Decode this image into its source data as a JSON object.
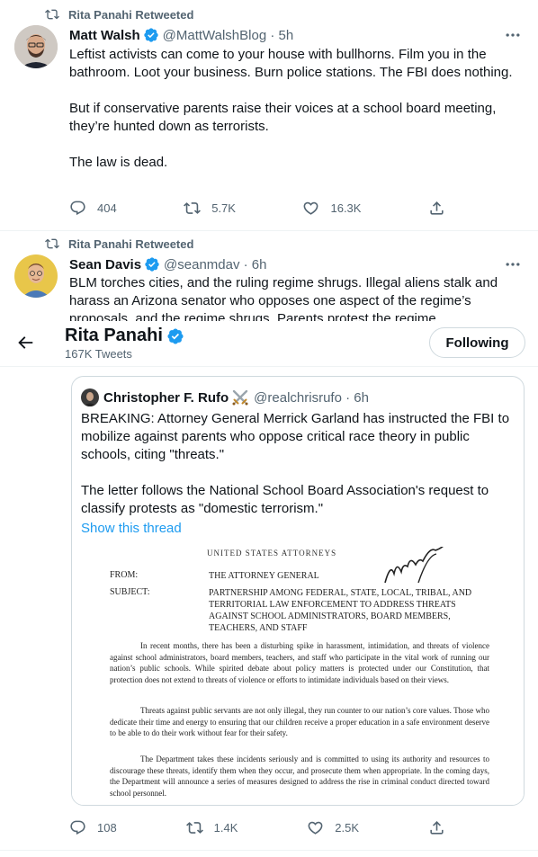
{
  "tweet1": {
    "retweet_label": "Rita Panahi Retweeted",
    "name": "Matt Walsh",
    "meta": "@MattWalshBlog · 5h",
    "paragraphs": [
      "Leftist activists can come to your house with bullhorns. Film you in the bathroom. Loot your business. Burn police stations. The FBI does nothing.",
      "But if conservative parents raise their voices at a school board meeting, they’re hunted down as terrorists.",
      "The law is dead."
    ],
    "replies": "404",
    "retweets": "5.7K",
    "likes": "16.3K"
  },
  "tweet2": {
    "retweet_label": "Rita Panahi Retweeted",
    "name": "Sean Davis",
    "meta": "@seanmdav · 6h",
    "text": "BLM torches cities, and the ruling regime shrugs. Illegal aliens stalk and harass an Arizona senator who opposes one aspect of the regime’s proposals, and the regime shrugs. Parents protest the regime"
  },
  "header": {
    "name": "Rita Panahi",
    "tweet_count": "167K Tweets",
    "follow_label": "Following"
  },
  "quote": {
    "name": "Christopher F. Rufo",
    "meta": "@realchrisrufo · 6h",
    "paragraphs": [
      "BREAKING: Attorney General Merrick Garland has instructed the FBI to mobilize against parents who oppose critical race theory in public schools, citing \"threats.\"",
      "The letter follows the National School Board Association's request to classify protests as \"domestic terrorism.\""
    ],
    "show_thread": "Show this thread",
    "document": {
      "header": "UNITED STATES ATTORNEYS",
      "from_label": "FROM:",
      "from_value": "THE ATTORNEY GENERAL",
      "subject_label": "SUBJECT:",
      "subject_value": "PARTNERSHIP AMONG FEDERAL, STATE, LOCAL, TRIBAL, AND TERRITORIAL LAW ENFORCEMENT TO ADDRESS THREATS AGAINST SCHOOL ADMINISTRATORS, BOARD MEMBERS, TEACHERS, AND STAFF",
      "para1": "In recent months, there has been a disturbing spike in harassment, intimidation, and threats of violence against school administrators, board members, teachers, and staff who participate in the vital work of running our nation’s public schools. While spirited debate about policy matters is protected under our Constitution, that protection does not extend to threats of violence or efforts to intimidate individuals based on their views.",
      "para2": "Threats against public servants are not only illegal, they run counter to our nation’s core values. Those who dedicate their time and energy to ensuring that our children receive a proper education in a safe environment deserve to be able to do their work without fear for their safety.",
      "para3": "The Department takes these incidents seriously and is committed to using its authority and resources to discourage these threats, identify them when they occur, and prosecute them when appropriate. In the coming days, the Department will announce a series of measures designed to address the rise in criminal conduct directed toward school personnel."
    }
  },
  "tweet3_actions": {
    "replies": "108",
    "retweets": "1.4K",
    "likes": "2.5K"
  },
  "colors": {
    "accent": "#1d9bf0",
    "secondary_text": "#536471",
    "border": "#eff3f4"
  },
  "icons": [
    "retweet-icon",
    "verified-badge-icon",
    "more-icon",
    "reply-icon",
    "like-icon",
    "share-icon",
    "back-arrow-icon",
    "crossed-swords-icon"
  ]
}
